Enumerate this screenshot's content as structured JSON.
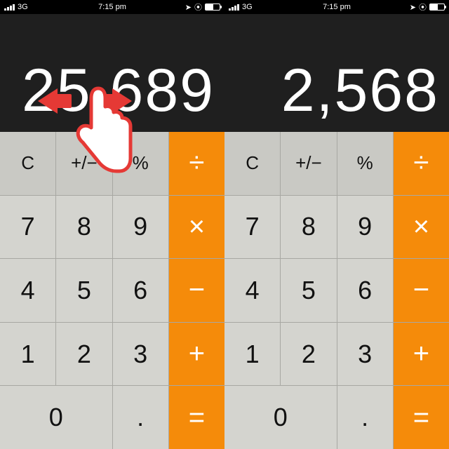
{
  "status_bar": {
    "carrier": "3G",
    "time": "7:15 pm",
    "location_icon": "location-arrow",
    "alarm_icon": "alarm",
    "battery_icon": "battery"
  },
  "screens": [
    {
      "display_value": "25,689",
      "shows_gesture": true
    },
    {
      "display_value": "2,568",
      "shows_gesture": false
    }
  ],
  "keys": {
    "clear": "C",
    "plusminus": "+/−",
    "percent": "%",
    "divide": "÷",
    "multiply": "×",
    "minus": "−",
    "plus": "+",
    "equals": "=",
    "decimal": ".",
    "n0": "0",
    "n1": "1",
    "n2": "2",
    "n3": "3",
    "n4": "4",
    "n5": "5",
    "n6": "6",
    "n7": "7",
    "n8": "8",
    "n9": "9"
  },
  "colors": {
    "operator_bg": "#f58b0a",
    "number_bg": "#d4d4cf",
    "function_bg": "#c9c9c4",
    "display_bg": "#1f1f1f",
    "gesture_red": "#e53935"
  }
}
